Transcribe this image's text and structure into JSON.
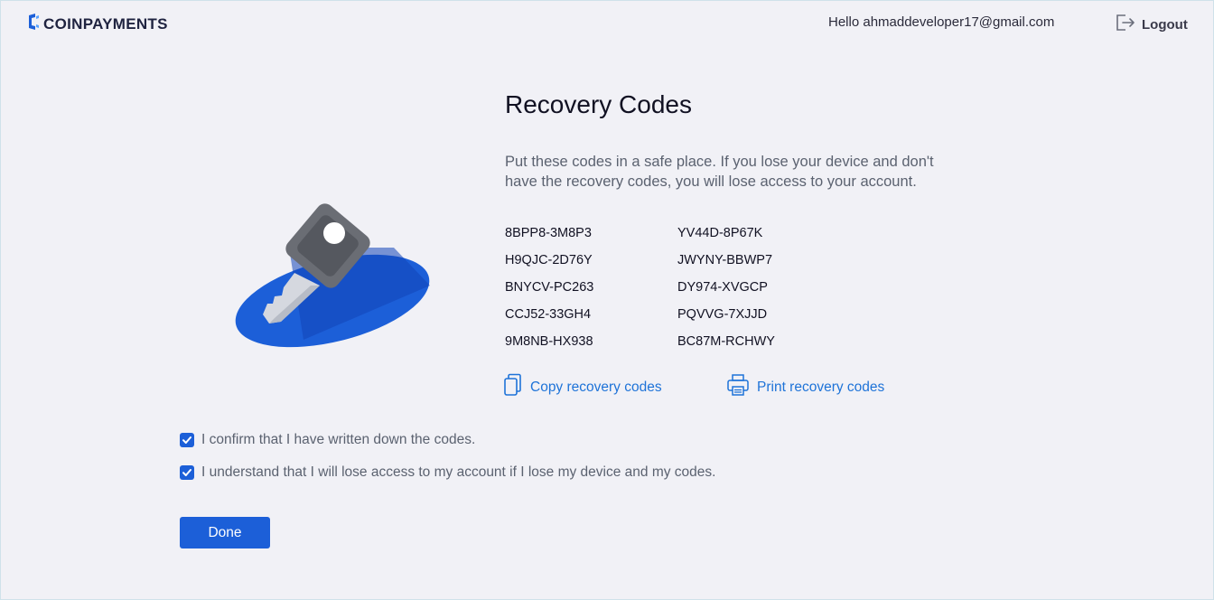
{
  "header": {
    "logo_text": "COINPAYMENTS",
    "greeting": "Hello ahmaddeveloper17@gmail.com",
    "logout_label": "Logout"
  },
  "main": {
    "title": "Recovery Codes",
    "description": "Put these codes in a safe place. If you lose your device and don't have the recovery codes, you will lose access to your account.",
    "codes": [
      "8BPP8-3M8P3",
      "YV44D-8P67K",
      "H9QJC-2D76Y",
      "JWYNY-BBWP7",
      "BNYCV-PC263",
      "DY974-XVGCP",
      "CCJ52-33GH4",
      "PQVVG-7XJJD",
      "9M8NB-HX938",
      "BC87M-RCHWY"
    ],
    "copy_label": "Copy recovery codes",
    "print_label": "Print recovery codes",
    "confirm_written": "I confirm that I have written down the codes.",
    "confirm_understand": "I understand that I will lose access to my account if I lose my device and my codes.",
    "done_label": "Done"
  },
  "icons": {
    "logo": "coinpayments-logo-icon",
    "logout": "logout-icon",
    "copy": "copy-icon",
    "print": "printer-icon",
    "checkbox": "checkmark-icon",
    "illustration": "key-illustration"
  },
  "colors": {
    "accent": "#1c5fd8",
    "link": "#1e73d8",
    "background": "#f1f1f6"
  }
}
